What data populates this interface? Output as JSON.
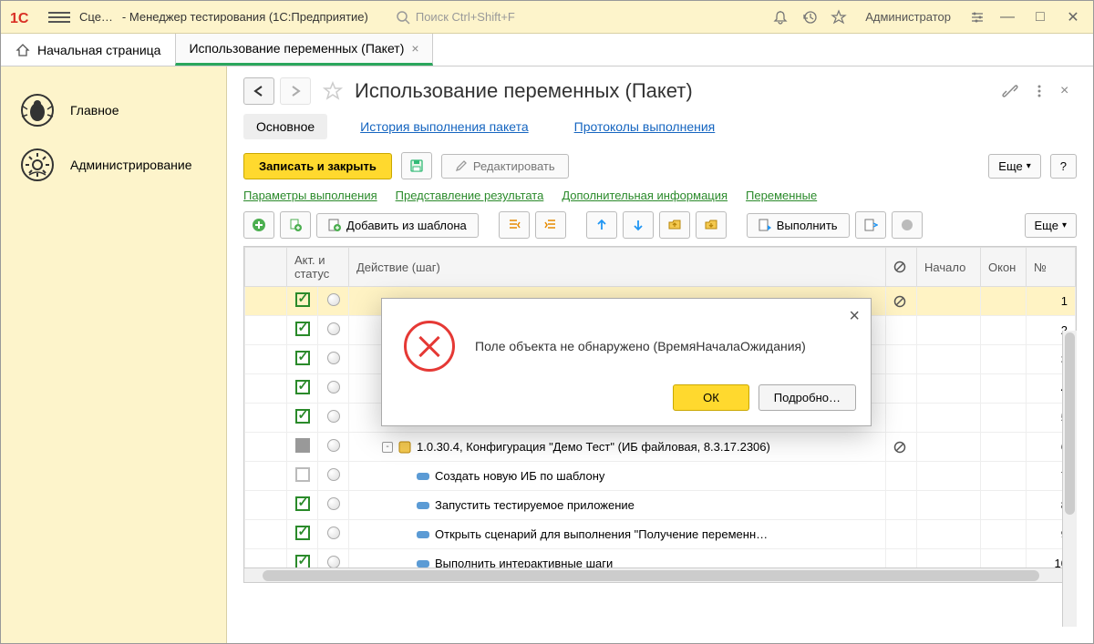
{
  "titlebar": {
    "app_name": "Сце…",
    "window_title": " - Менеджер тестирования (1С:Предприятие)",
    "search_placeholder": "Поиск Ctrl+Shift+F",
    "user": "Администратор"
  },
  "tabs": {
    "home": "Начальная страница",
    "doc": "Использование переменных (Пакет)"
  },
  "sidebar": {
    "items": [
      {
        "label": "Главное"
      },
      {
        "label": "Администрирование"
      }
    ]
  },
  "page": {
    "title": "Использование переменных (Пакет)",
    "section_tabs": {
      "main": "Основное",
      "history": "История выполнения пакета",
      "protocols": "Протоколы выполнения"
    },
    "toolbar": {
      "save_close": "Записать и закрыть",
      "edit": "Редактировать",
      "more": "Еще",
      "help": "?"
    },
    "links": {
      "params": "Параметры выполнения",
      "result": "Представление результата",
      "extra": "Дополнительная информация",
      "vars": "Переменные"
    },
    "toolbar2": {
      "add_template": "Добавить из шаблона",
      "execute": "Выполнить",
      "more": "Еще"
    },
    "grid": {
      "headers": {
        "act": "Акт. и  статус",
        "action": "Действие (шаг)",
        "start": "Начало",
        "end": "Окон",
        "num": "№"
      },
      "rows": [
        {
          "checked": true,
          "num": 1,
          "selected": true,
          "banned": true,
          "text": "",
          "indent": 0
        },
        {
          "checked": true,
          "num": 2,
          "text": "",
          "indent": 0
        },
        {
          "checked": true,
          "num": 3,
          "text": "",
          "indent": 0
        },
        {
          "checked": true,
          "num": 4,
          "text": "",
          "indent": 0
        },
        {
          "checked": true,
          "num": 5,
          "text": "",
          "indent": 0
        },
        {
          "checked": "square",
          "num": 6,
          "banned": true,
          "expand": "-",
          "icon": "cfg",
          "text": "1.0.30.4, Конфигурация \"Демо Тест\" (ИБ файловая, 8.3.17.2306)",
          "indent": 28
        },
        {
          "checked": "empty",
          "num": 7,
          "pill": true,
          "text": "Создать новую ИБ по шаблону",
          "indent": 66
        },
        {
          "checked": true,
          "num": 8,
          "pill": true,
          "text": "Запустить тестируемое приложение",
          "indent": 66
        },
        {
          "checked": true,
          "num": 9,
          "pill": true,
          "text": "Открыть сценарий для выполнения \"Получение переменн…",
          "indent": 66
        },
        {
          "checked": true,
          "num": 10,
          "pill": true,
          "text": "Выполнить интерактивные шаги",
          "indent": 66
        }
      ]
    }
  },
  "dialog": {
    "message": "Поле объекта не обнаружено (ВремяНачалаОжидания)",
    "ok": "ОК",
    "details": "Подробно…"
  }
}
